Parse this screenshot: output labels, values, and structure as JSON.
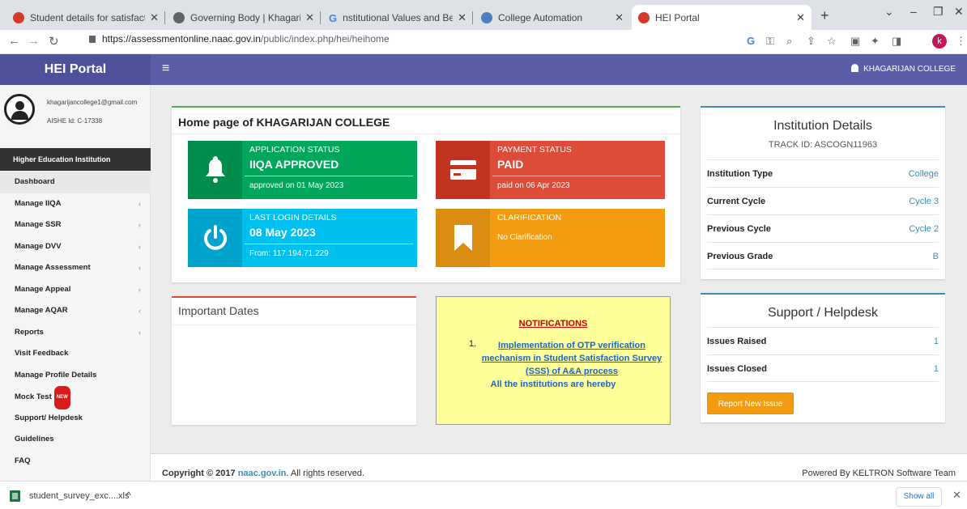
{
  "browser": {
    "tabs": [
      {
        "title": "Student details for satisfactio",
        "favicon": "naac-icon"
      },
      {
        "title": "Governing Body | Khagarijan",
        "favicon": "globe-icon"
      },
      {
        "title": "nstitutional Values and Best F",
        "favicon": "google-icon"
      },
      {
        "title": "College Automation",
        "favicon": "college-icon"
      },
      {
        "title": "HEI Portal",
        "favicon": "naac-icon"
      }
    ],
    "url_host": "https://assessmentonline.naac.gov.in",
    "url_path": "/public/index.php/hei/heihome",
    "profile_initial": "k"
  },
  "header": {
    "brand": "HEI Portal",
    "menu_icon": "≡",
    "user": "KHAGARIJAN COLLEGE"
  },
  "sidebar": {
    "email": "khagarijancollege1@gmail.com",
    "aishe": "AISHE Id: C-17338",
    "section": "Higher Education Institution",
    "items": [
      {
        "label": "Dashboard",
        "chev": ""
      },
      {
        "label": "Manage IIQA",
        "chev": "‹"
      },
      {
        "label": "Manage SSR",
        "chev": "‹"
      },
      {
        "label": "Manage DVV",
        "chev": "‹"
      },
      {
        "label": "Manage Assessment",
        "chev": "‹"
      },
      {
        "label": "Manage Appeal",
        "chev": "‹"
      },
      {
        "label": "Manage AQAR",
        "chev": "‹"
      },
      {
        "label": "Reports",
        "chev": "‹"
      },
      {
        "label": "Visit Feedback",
        "chev": ""
      },
      {
        "label": "Manage Profile Details",
        "chev": ""
      },
      {
        "label": "Mock Test",
        "chev": "",
        "badge": "NEW"
      },
      {
        "label": "Support/ Helpdesk",
        "chev": ""
      },
      {
        "label": "Guidelines",
        "chev": ""
      },
      {
        "label": "FAQ",
        "chev": ""
      }
    ]
  },
  "home": {
    "title": "Home page of KHAGARIJAN COLLEGE",
    "boxes": [
      {
        "caption": "APPLICATION STATUS",
        "value": "IIQA APPROVED",
        "sub": "approved on 01 May 2023",
        "icon": "bell-icon"
      },
      {
        "caption": "PAYMENT STATUS",
        "value": "PAID",
        "sub": "paid on 06 Apr 2023",
        "icon": "credit-card-icon"
      },
      {
        "caption": "LAST LOGIN DETAILS",
        "value": "08 May 2023",
        "sub": "From: 117.194.71.229",
        "icon": "power-icon"
      },
      {
        "caption": "CLARIFICATION",
        "value": "",
        "sub": "No Clarification",
        "icon": "bookmark-icon"
      }
    ]
  },
  "important_dates": {
    "title": "Important Dates"
  },
  "notifications": {
    "heading": "NOTIFICATIONS",
    "number": "1.",
    "link": "Implementation of OTP verification mechanism in Student Satisfaction Survey (SSS) of A&A process",
    "more": "All the institutions are hereby"
  },
  "institution": {
    "title": "Institution Details",
    "track": "TRACK ID: ASCOGN11963",
    "rows": [
      {
        "label": "Institution Type",
        "value": "College"
      },
      {
        "label": "Current Cycle",
        "value": "Cycle 3"
      },
      {
        "label": "Previous Cycle",
        "value": "Cycle 2"
      },
      {
        "label": "Previous Grade",
        "value": "B"
      }
    ]
  },
  "helpdesk": {
    "title": "Support / Helpdesk",
    "rows": [
      {
        "label": "Issues Raised",
        "value": "1"
      },
      {
        "label": "Issues Closed",
        "value": "1"
      }
    ],
    "button": "Report New Issue"
  },
  "footer": {
    "copyright_prefix": "Copyright © 2017 ",
    "copyright_link": "naac.gov.in",
    "copyright_suffix": ". All rights reserved.",
    "powered": "Powered By KELTRON Software Team"
  },
  "downloads": {
    "file": "student_survey_exc....xls",
    "show_all": "Show all"
  },
  "colors": {
    "header": "#5b5ea6",
    "green": "#00a65a",
    "red": "#dd4b39",
    "aqua": "#00c0ef",
    "orange": "#f39c12"
  }
}
